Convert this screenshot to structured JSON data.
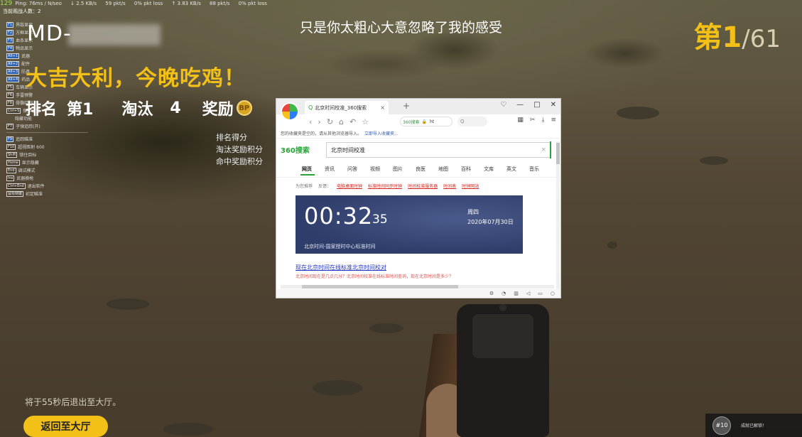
{
  "hud": {
    "fps": "129",
    "net_stats": [
      "Ping: 76ms / N/seo",
      "↓ 2.5 KB/s",
      "59 pkt/s",
      "0% pkt loss",
      "↑ 3.83 KB/s",
      "88 pkt/s",
      "0% pkt loss"
    ],
    "count_line": "当前观战人数：2",
    "hotkeys": [
      {
        "key": "F1",
        "label": "界敌显示"
      },
      {
        "key": "F2",
        "label": "方框显示"
      },
      {
        "key": "F3",
        "label": "血条显示"
      },
      {
        "key": "F4",
        "label": "物品显示"
      },
      {
        "key": "Alt+1",
        "label": "武器"
      },
      {
        "key": "Alt+2",
        "label": "配件"
      },
      {
        "key": "Alt+3",
        "label": "防具"
      },
      {
        "key": "Alt+4",
        "label": "药品"
      },
      {
        "key": "F5",
        "label": "车辆显示"
      },
      {
        "key": "F6",
        "label": "手雷预警"
      },
      {
        "key": "F8",
        "label": "骨骼绘制"
      },
      {
        "key": "Ctrl+S",
        "label": "保存设置"
      },
      {
        "key": "",
        "label": "隐藏功能"
      },
      {
        "key": "F7",
        "label": "子弹追踪(开)"
      }
    ],
    "hotkeys_second": [
      {
        "key": "F9",
        "label": "追踪瞄准"
      },
      {
        "key": "F10",
        "label": "超视距射 600"
      },
      {
        "key": "Shift",
        "label": "锁住目标"
      },
      {
        "key": "Home",
        "label": "显示隐藏"
      },
      {
        "key": "End",
        "label": "调试模式"
      },
      {
        "key": "Ins",
        "label": "武器换枪"
      },
      {
        "key": "Ctrl+End",
        "label": "退出软件"
      },
      {
        "key": "鼠标侧键",
        "label": "初定瞄准"
      }
    ]
  },
  "result": {
    "player_name": "MD-",
    "winner_text": "大吉大利，今晚吃鸡！",
    "rank_label": "排名",
    "rank_value": "第1",
    "kills_label": "淘汰",
    "kills_value": "4",
    "reward_label": "奖励",
    "coin_icon": "BP",
    "score_lines": [
      "排名得分",
      "淘汰奖励积分",
      "命中奖励积分"
    ],
    "big_rank": "第1",
    "big_total": "/61",
    "exit_note": "将于55秒后退出至大厅。",
    "lobby_button": "返回至大厅"
  },
  "subtitle": "只是你太粗心大意忽略了我的感受",
  "notification": {
    "icon_text": "#10",
    "text": "成就已解锁！"
  },
  "browser": {
    "tab_title": "北京时间校准_360搜索",
    "tab_close": "×",
    "new_tab": "+",
    "win_controls": [
      "♡",
      "—",
      "□",
      "✕"
    ],
    "address_text": "360搜索",
    "address_suffix": "ht",
    "search_mini": "Q",
    "infobar_text": "您的收藏夹是空的，请从其他浏览器导入。",
    "infobar_link": "立即导入收藏夹...",
    "logo_text": "360搜索",
    "query": "北京时间校准",
    "clear": "×",
    "tabs": [
      "网页",
      "资讯",
      "问答",
      "视频",
      "图片",
      "良医",
      "地图",
      "百科",
      "文库",
      "英文",
      "音乐"
    ],
    "suggest_prefix": "为您推荐",
    "suggest_feedback": "反馈：",
    "suggestions": [
      "电脑桌面时钟",
      "标准时间同步时钟",
      "时间校准服务器",
      "时间表",
      "时钟网站"
    ],
    "clock": {
      "time": "00:32",
      "seconds": "35",
      "weekday": "周四",
      "date": "2020年07月30日",
      "source": "北京时间-国家授时中心标准时间"
    },
    "result_link": "现在北京时间在线标准北京时间校对",
    "result_desc": "北京时间现在是几点几分？北京时间校准在线标准时间查询，现在北京时间是多少？"
  }
}
